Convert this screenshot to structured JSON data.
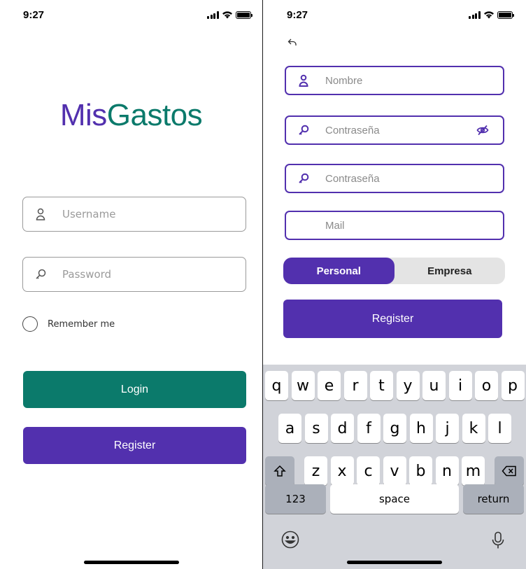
{
  "status": {
    "time": "9:27"
  },
  "login": {
    "logo_part1": "Mis",
    "logo_part2": "Gastos",
    "username_placeholder": "Username",
    "password_placeholder": "Password",
    "remember_label": "Remember me",
    "login_label": "Login",
    "register_label": "Register"
  },
  "register": {
    "name_placeholder": "Nombre",
    "password_placeholder": "Contraseña",
    "password_confirm_placeholder": "Contraseña",
    "mail_placeholder": "Mail",
    "segment_personal": "Personal",
    "segment_empresa": "Empresa",
    "register_label": "Register"
  },
  "keyboard": {
    "row1": [
      "q",
      "w",
      "e",
      "r",
      "t",
      "y",
      "u",
      "i",
      "o",
      "p"
    ],
    "row2": [
      "a",
      "s",
      "d",
      "f",
      "g",
      "h",
      "j",
      "k",
      "l"
    ],
    "row3": [
      "z",
      "x",
      "c",
      "v",
      "b",
      "n",
      "m"
    ],
    "numbers_label": "123",
    "space_label": "space",
    "return_label": "return"
  },
  "colors": {
    "brand_purple": "#5230ae",
    "brand_green": "#0b7a6b"
  },
  "icons": [
    "person-icon",
    "key-icon",
    "eye-slash-icon",
    "back-icon",
    "shift-icon",
    "delete-icon",
    "emoji-icon",
    "mic-icon"
  ]
}
